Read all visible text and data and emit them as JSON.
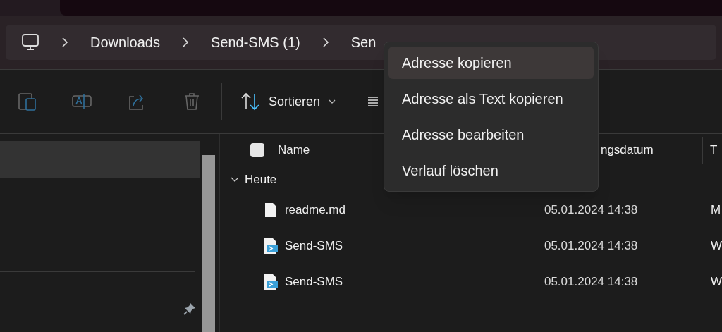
{
  "breadcrumb": [
    "Downloads",
    "Send-SMS (1)",
    "Sen"
  ],
  "select_all": {
    "checked": false
  },
  "toolbar": {
    "sort_label": "Sortieren"
  },
  "columns": [
    "Name",
    "ngsdatum",
    "T"
  ],
  "group": {
    "label": "Heute",
    "expanded": true
  },
  "files": [
    {
      "kind": "text",
      "name": "readme.md",
      "date": "05.01.2024 14:38",
      "type": "M"
    },
    {
      "kind": "script",
      "name": "Send-SMS",
      "date": "05.01.2024 14:38",
      "type": "W"
    },
    {
      "kind": "script",
      "name": "Send-SMS",
      "date": "05.01.2024 14:38",
      "type": "W"
    }
  ],
  "context_menu": [
    {
      "label": "Adresse kopieren",
      "selected": true
    },
    {
      "label": "Adresse als Text kopieren",
      "selected": false
    },
    {
      "label": "Adresse bearbeiten",
      "selected": false
    },
    {
      "label": "Verlauf löschen",
      "selected": false
    }
  ]
}
